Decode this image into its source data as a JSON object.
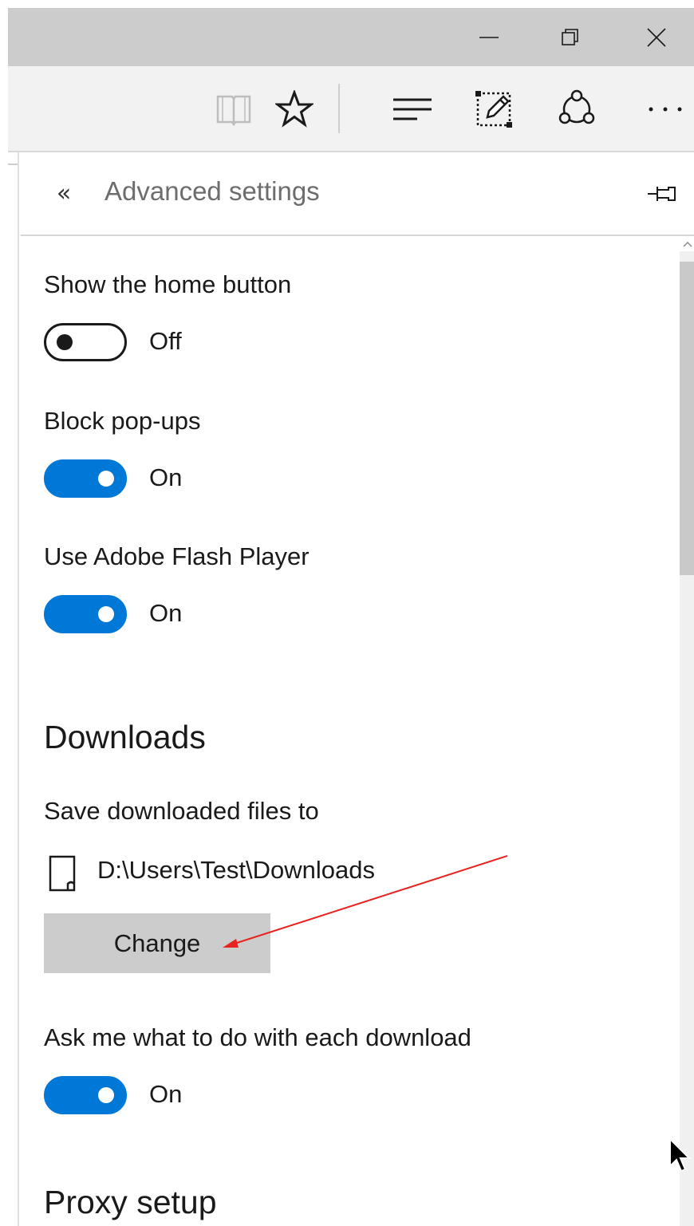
{
  "window": {
    "minimize_icon": "minimize-icon",
    "restore_icon": "restore-icon",
    "close_icon": "close-icon"
  },
  "toolbar": {
    "icons": [
      "reading-view-icon",
      "favorite-star-icon",
      "hub-icon",
      "web-note-icon",
      "share-icon",
      "more-icon"
    ],
    "more_label": "···"
  },
  "panel": {
    "back_label": "«",
    "title": "Advanced settings",
    "pin_icon": "pin-icon"
  },
  "settings": {
    "home_button": {
      "label": "Show the home button",
      "state": "Off"
    },
    "block_popups": {
      "label": "Block pop-ups",
      "state": "On"
    },
    "flash": {
      "label": "Use Adobe Flash Player",
      "state": "On"
    }
  },
  "downloads": {
    "heading": "Downloads",
    "save_label": "Save downloaded files to",
    "path": "D:\\Users\\Test\\Downloads",
    "change_label": "Change",
    "ask": {
      "label": "Ask me what to do with each download",
      "state": "On"
    }
  },
  "proxy": {
    "heading": "Proxy setup"
  },
  "colors": {
    "accent": "#0078d7",
    "annotation": "#e8231f",
    "button_bg": "#cccccc",
    "titlebar_bg": "#cccccc"
  }
}
